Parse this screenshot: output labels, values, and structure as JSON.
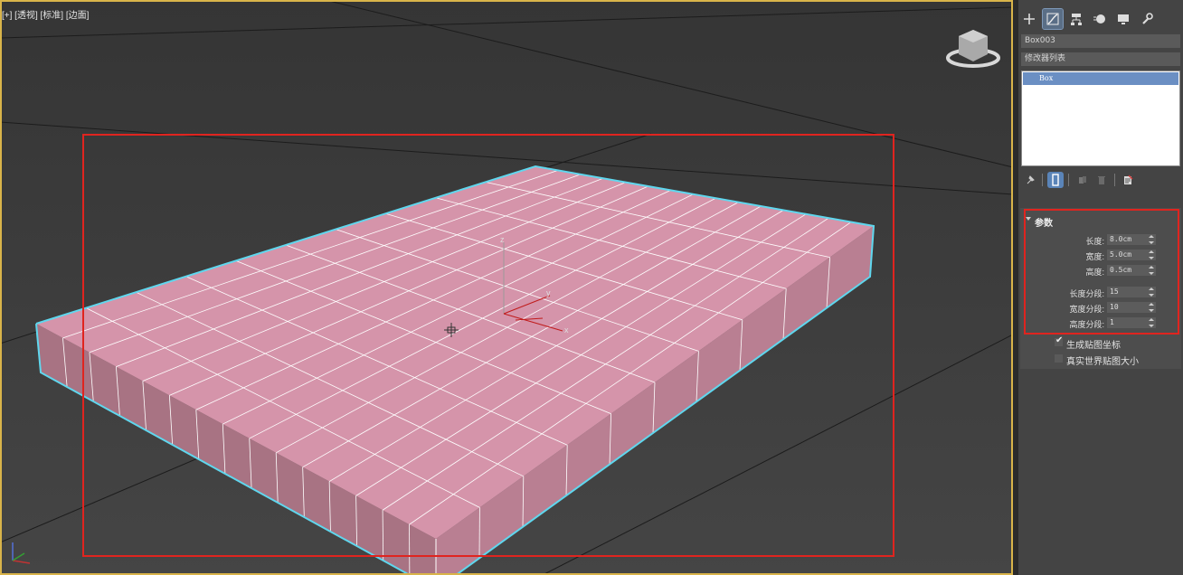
{
  "viewport": {
    "label": "[+] [透视] [标准] [边面]",
    "mesh": {
      "length_segments": 15,
      "width_segments": 10
    },
    "colors": {
      "box_top": "#d594aa",
      "box_front": "#a87383",
      "box_side": "#b97f92",
      "selection_outline": "#5fd7ee",
      "highlight_box": "#e0241f"
    },
    "gizmo_axes": {
      "x": "x",
      "y": "y",
      "z": "z"
    }
  },
  "command_panel": {
    "tabs": [
      {
        "name": "create",
        "icon": "plus-icon"
      },
      {
        "name": "modify",
        "icon": "modify-icon",
        "active": true
      },
      {
        "name": "hierarchy",
        "icon": "hierarchy-icon"
      },
      {
        "name": "motion",
        "icon": "motion-icon"
      },
      {
        "name": "display",
        "icon": "display-icon"
      },
      {
        "name": "utilities",
        "icon": "wrench-icon"
      }
    ],
    "object_name": "Box003",
    "modifier_list": "修改器列表",
    "stack": {
      "selected": "Box"
    },
    "params": {
      "title": "参数",
      "length_label": "长度:",
      "length_value": "8.0cm",
      "width_label": "宽度:",
      "width_value": "5.0cm",
      "height_label": "高度:",
      "height_value": "0.5cm",
      "length_segs_label": "长度分段:",
      "length_segs_value": "15",
      "width_segs_label": "宽度分段:",
      "width_segs_value": "10",
      "height_segs_label": "高度分段:",
      "height_segs_value": "1",
      "gen_map_coords_label": "生成贴图坐标",
      "gen_map_coords_checked": true,
      "real_world_map_label": "真实世界贴图大小",
      "real_world_map_checked": false
    }
  }
}
